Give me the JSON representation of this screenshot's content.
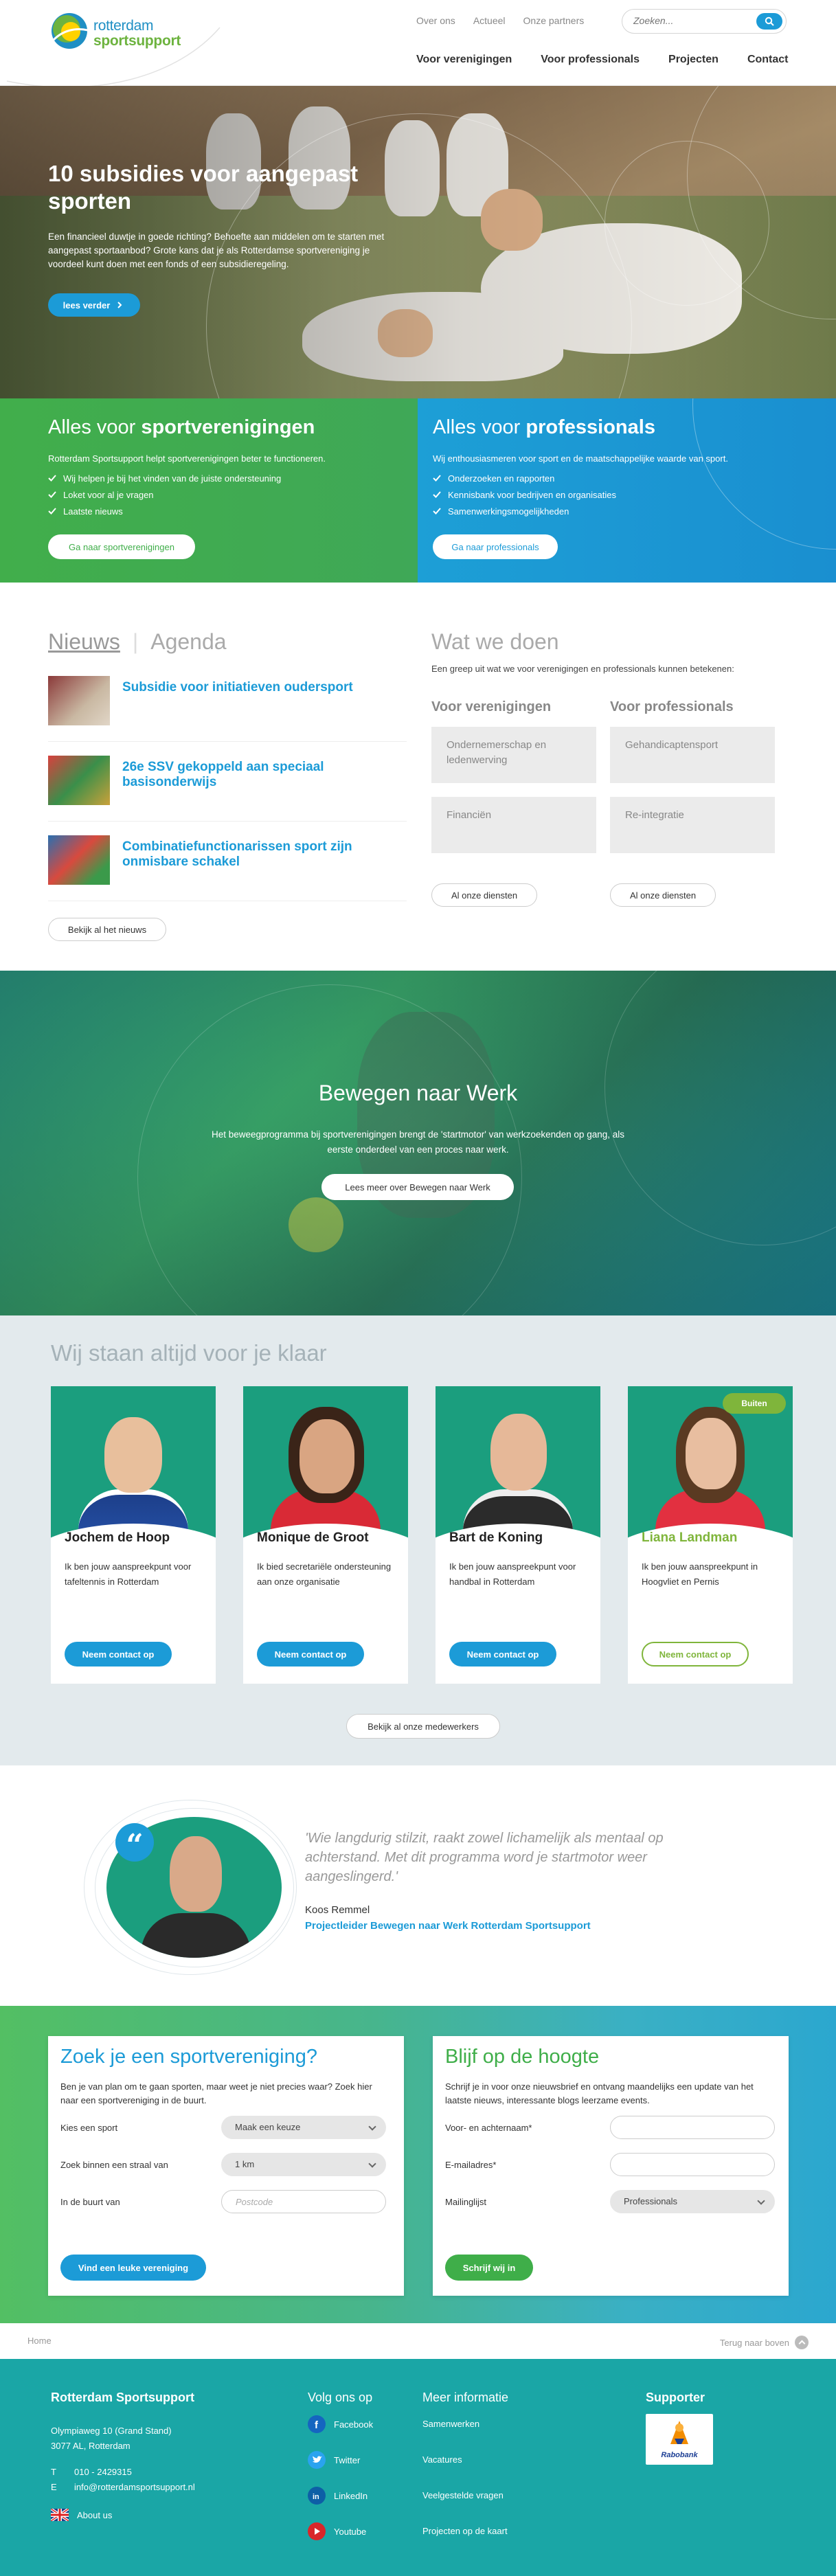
{
  "header": {
    "brand_line1": "rotterdam",
    "brand_line2": "sportsupport",
    "top_links": [
      "Over ons",
      "Actueel",
      "Onze partners"
    ],
    "search_placeholder": "Zoeken...",
    "nav": [
      "Voor verenigingen",
      "Voor professionals",
      "Projecten",
      "Contact"
    ]
  },
  "hero": {
    "title": "10 subsidies voor aangepast sporten",
    "text": "Een financieel duwtje in goede richting? Behoefte aan middelen om te starten met aangepast sportaanbod? Grote kans dat je als Rotterdamse sportvereniging je voordeel kunt doen met een fonds of een subsidieregeling.",
    "button": "lees verder"
  },
  "split": {
    "left": {
      "title_pre": "Alles voor ",
      "title_bold": "sportverenigingen",
      "intro": "Rotterdam Sportsupport helpt sportverenigingen beter te functioneren.",
      "items": [
        "Wij helpen je bij het vinden van de juiste ondersteuning",
        "Loket voor al je vragen",
        "Laatste nieuws"
      ],
      "button": "Ga naar sportverenigingen",
      "color": "#3fae49"
    },
    "right": {
      "title_pre": "Alles voor ",
      "title_bold": "professionals",
      "intro": "Wij enthousiasmeren voor sport en de maatschappelijke waarde van sport.",
      "items": [
        "Onderzoeken en rapporten",
        "Kennisbank voor bedrijven en organisaties",
        "Samenwerkingsmogelijkheden"
      ],
      "button": "Ga naar professionals",
      "color": "#1c9bd7"
    }
  },
  "news": {
    "tab_active": "Nieuws",
    "tab_inactive": "Agenda",
    "items": [
      {
        "title": "Subsidie voor initiatieven oudersport"
      },
      {
        "title": "26e SSV gekoppeld aan speciaal basisonderwijs"
      },
      {
        "title": "Combinatiefunctionarissen sport zijn onmisbare schakel"
      }
    ],
    "all_button": "Bekijk al het nieuws"
  },
  "wwd": {
    "title": "Wat we doen",
    "subtitle": "Een greep uit wat we voor verenigingen en professionals kunnen betekenen:",
    "col1": {
      "heading": "Voor verenigingen",
      "boxes": [
        "Ondernemerschap en ledenwerving",
        "Financiën"
      ],
      "button": "Al onze diensten"
    },
    "col2": {
      "heading": "Voor professionals",
      "boxes": [
        "Gehandicaptensport",
        "Re-integratie"
      ],
      "button": "Al onze diensten"
    }
  },
  "bewegen": {
    "title": "Bewegen naar Werk",
    "text": "Het beweegprogramma bij sportverenigingen brengt de 'startmotor' van werkzoekenden op gang, als eerste onderdeel van een proces naar werk.",
    "button": "Lees meer over Bewegen naar Werk"
  },
  "team": {
    "title": "Wij staan altijd voor je klaar",
    "members": [
      {
        "name": "Jochem de Hoop",
        "desc": "Ik ben jouw aanspreekpunt voor tafeltennis in Rotterdam",
        "button": "Neem contact op",
        "badge": ""
      },
      {
        "name": "Monique de Groot",
        "desc": "Ik bied secretariële ondersteuning aan onze organisatie",
        "button": "Neem contact op",
        "badge": ""
      },
      {
        "name": "Bart de Koning",
        "desc": "Ik ben jouw aanspreekpunt voor handbal in Rotterdam",
        "button": "Neem contact op",
        "badge": ""
      },
      {
        "name": "Liana Landman",
        "desc": "Ik ben jouw aanspreekpunt in Hoogvliet en Pernis",
        "button": "Neem contact op",
        "badge": "Buiten"
      }
    ],
    "all_button": "Bekijk al onze medewerkers"
  },
  "quote": {
    "text": "'Wie langdurig stilzit, raakt zowel lichamelijk als mentaal op achterstand. Met dit programma word je startmotor weer aangeslingerd.'",
    "author": "Koos Remmel",
    "role": "Projectleider Bewegen naar Werk Rotterdam Sportsupport"
  },
  "search_club": {
    "title": "Zoek je een sportvereniging?",
    "intro": "Ben je van plan om te gaan sporten, maar weet je niet precies waar? Zoek hier naar een sportvereniging in de buurt.",
    "sport_label": "Kies een sport",
    "sport_value": "Maak een keuze",
    "radius_label": "Zoek binnen een straal van",
    "radius_value": "1 km",
    "postcode_label": "In de buurt van",
    "postcode_placeholder": "Postcode",
    "button": "Vind een leuke vereniging"
  },
  "newsletter": {
    "title": "Blijf op de hoogte",
    "intro": "Schrijf je in voor onze nieuwsbrief en ontvang maandelijks een update van het laatste nieuws, interessante blogs leerzame events.",
    "name_label": "Voor- en achternaam*",
    "email_label": "E-mailadres*",
    "list_label": "Mailinglijst",
    "list_value": "Professionals",
    "button": "Schrijf wij in"
  },
  "breadcrumb": {
    "home": "Home",
    "back_top": "Terug naar boven"
  },
  "footer": {
    "org": "Rotterdam Sportsupport",
    "address1": "Olympiaweg 10 (Grand Stand)",
    "address2": "3077 AL, Rotterdam",
    "tel_label": "T",
    "tel": "010 - 2429315",
    "email_label": "E",
    "email": "info@rotterdamsportsupport.nl",
    "about": "About us",
    "social_title": "Volg ons op",
    "social": [
      "Facebook",
      "Twitter",
      "LinkedIn",
      "Youtube"
    ],
    "more_title": "Meer informatie",
    "more": [
      "Samenwerken",
      "Vacatures",
      "Veelgestelde vragen",
      "Projecten op de kaart"
    ],
    "supporter_title": "Supporter",
    "supporter": "Rabobank"
  }
}
